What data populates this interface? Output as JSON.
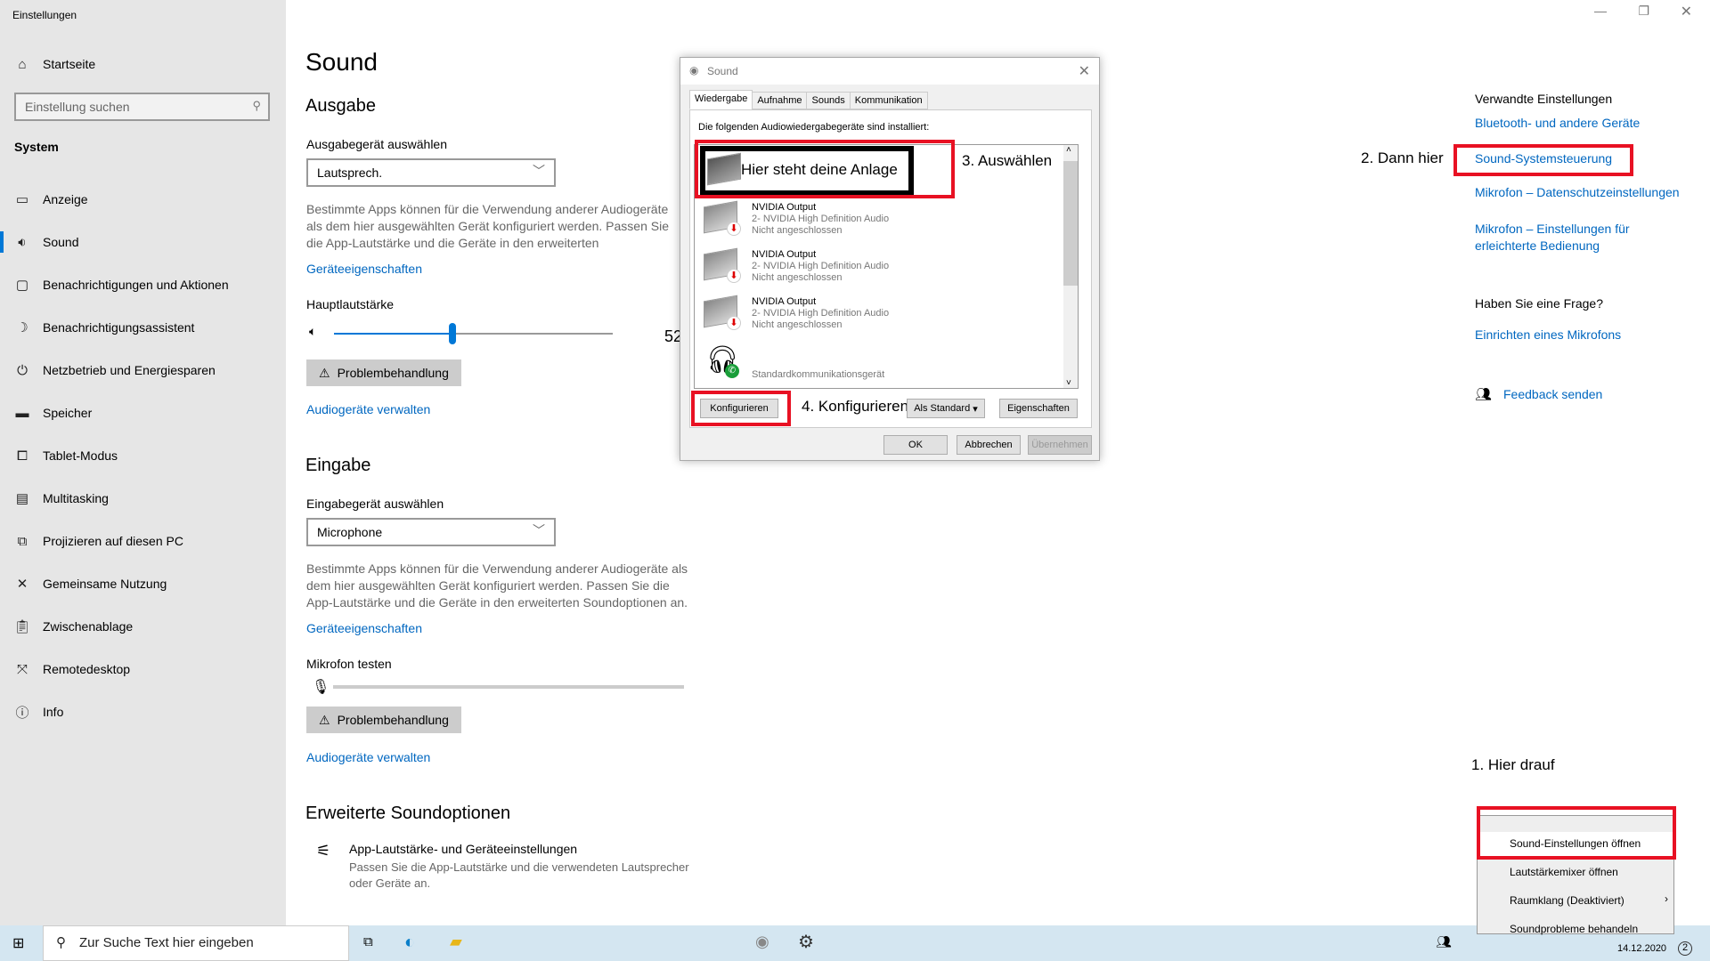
{
  "window": {
    "title": "Einstellungen",
    "controls": [
      "minimize",
      "restore",
      "close"
    ]
  },
  "sidebar": {
    "home": "Startseite",
    "search_placeholder": "Einstellung suchen",
    "section": "System",
    "items": [
      {
        "label": "Anzeige",
        "icon": "display-icon"
      },
      {
        "label": "Sound",
        "icon": "speaker-icon",
        "active": true
      },
      {
        "label": "Benachrichtigungen und Aktionen",
        "icon": "notification-icon"
      },
      {
        "label": "Benachrichtigungsassistent",
        "icon": "moon-icon"
      },
      {
        "label": "Netzbetrieb und Energiesparen",
        "icon": "power-icon"
      },
      {
        "label": "Speicher",
        "icon": "storage-icon"
      },
      {
        "label": "Tablet-Modus",
        "icon": "tablet-icon"
      },
      {
        "label": "Multitasking",
        "icon": "multitasking-icon"
      },
      {
        "label": "Projizieren auf diesen PC",
        "icon": "project-icon"
      },
      {
        "label": "Gemeinsame Nutzung",
        "icon": "share-icon"
      },
      {
        "label": "Zwischenablage",
        "icon": "clipboard-icon"
      },
      {
        "label": "Remotedesktop",
        "icon": "remote-icon"
      },
      {
        "label": "Info",
        "icon": "info-icon"
      }
    ]
  },
  "main": {
    "title": "Sound",
    "output": {
      "heading": "Ausgabe",
      "select_label": "Ausgabegerät auswählen",
      "selected": "Lautsprech.",
      "desc": "Bestimmte Apps können für die Verwendung anderer Audiogeräte als dem hier ausgewählten Gerät konfiguriert werden. Passen Sie die App-Lautstärke und die Geräte in den erweiterten Soundoptionen an.",
      "props_link": "Geräteeigenschaften",
      "volume_label": "Hauptlautstärke",
      "volume": 52,
      "volume_text": "52",
      "troubleshoot": "Problembehandlung",
      "manage_link": "Audiogeräte verwalten"
    },
    "input": {
      "heading": "Eingabe",
      "select_label": "Eingabegerät auswählen",
      "selected": "Microphone",
      "desc": "Bestimmte Apps können für die Verwendung anderer Audiogeräte als dem hier ausgewählten Gerät konfiguriert werden. Passen Sie die App-Lautstärke und die Geräte in den erweiterten Soundoptionen an.",
      "props_link": "Geräteeigenschaften",
      "test_label": "Mikrofon testen",
      "troubleshoot": "Problembehandlung",
      "manage_link": "Audiogeräte verwalten"
    },
    "advanced": {
      "heading": "Erweiterte Soundoptionen",
      "item_title": "App-Lautstärke- und Geräteeinstellungen",
      "item_desc": "Passen Sie die App-Lautstärke und die verwendeten Lautsprecher oder Geräte an."
    }
  },
  "related": {
    "heading": "Verwandte Einstellungen",
    "links": [
      "Bluetooth- und andere Geräte",
      "Sound-Systemsteuerung",
      "Mikrofon – Datenschutzeinstellungen",
      "Mikrofon – Einstellungen für erleichterte Bedienung"
    ],
    "question": "Haben Sie eine Frage?",
    "help_link": "Einrichten eines Mikrofons",
    "feedback": "Feedback senden"
  },
  "dialog": {
    "title": "Sound",
    "tabs": [
      "Wiedergabe",
      "Aufnahme",
      "Sounds",
      "Kommunikation"
    ],
    "intro": "Die folgenden Audiowiedergabegeräte sind installiert:",
    "devices": [
      {
        "name": "Hier steht deine Anlage"
      },
      {
        "name": "NVIDIA Output",
        "sub": "2- NVIDIA High Definition Audio",
        "status": "Nicht angeschlossen"
      },
      {
        "name": "NVIDIA Output",
        "sub": "2- NVIDIA High Definition Audio",
        "status": "Nicht angeschlossen"
      },
      {
        "name": "NVIDIA Output",
        "sub": "2- NVIDIA High Definition Audio",
        "status": "Nicht angeschlossen"
      },
      {
        "name": "",
        "status": "Standardkommunikationsgerät"
      }
    ],
    "configure": "Konfigurieren",
    "set_default": "Als Standard",
    "properties": "Eigenschaften",
    "ok": "OK",
    "cancel": "Abbrechen",
    "apply": "Übernehmen"
  },
  "annotations": {
    "step1": "1. Hier drauf",
    "step2": "2. Dann hier",
    "step3": "3. Auswählen",
    "step4": "4. Konfigurieren"
  },
  "context_menu": [
    "Sound-Einstellungen öffnen",
    "Lautstärkemixer öffnen",
    "Raumklang (Deaktiviert)",
    "Soundprobleme behandeln"
  ],
  "taskbar": {
    "search_placeholder": "Zur Suche Text hier eingeben",
    "date": "14.12.2020",
    "notifications": "2"
  },
  "colors": {
    "accent": "#0078d7",
    "link": "#0067c0",
    "annotation_red": "#e81123"
  }
}
